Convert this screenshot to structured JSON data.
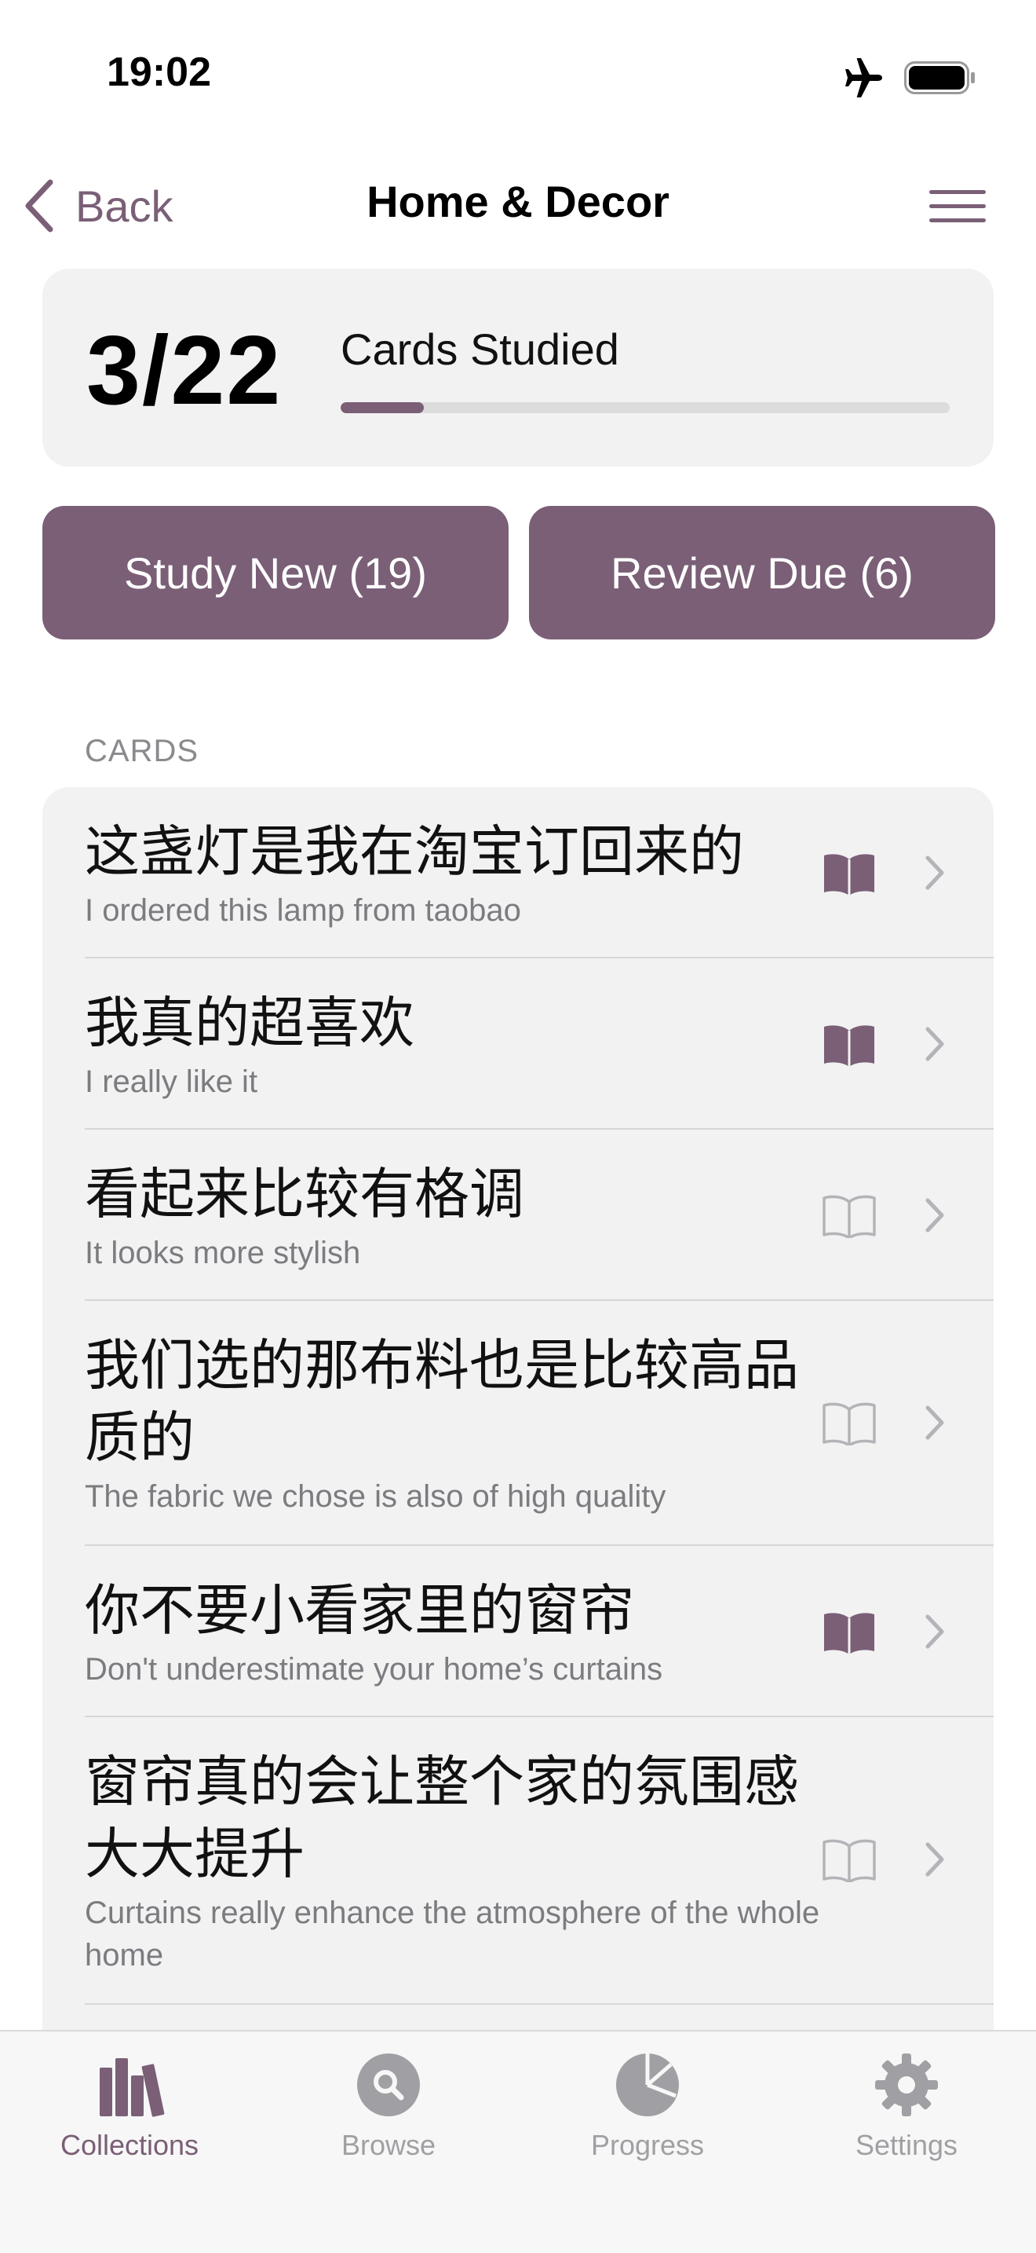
{
  "status_bar": {
    "time": "19:02"
  },
  "nav": {
    "back_label": "Back",
    "title": "Home & Decor"
  },
  "progress": {
    "count": "3/22",
    "label": "Cards Studied",
    "studied": 3,
    "total": 22
  },
  "actions": {
    "study_new": "Study New (19)",
    "review_due": "Review Due (6)"
  },
  "cards_header": "CARDS",
  "cards": [
    {
      "chinese": "这盏灯是我在淘宝订回来的",
      "english": "I ordered this lamp from taobao",
      "studied": true
    },
    {
      "chinese": "我真的超喜欢",
      "english": "I really like it",
      "studied": true
    },
    {
      "chinese": "看起来比较有格调",
      "english": "It looks more stylish",
      "studied": false
    },
    {
      "chinese": "我们选的那布料也是比较高品质的",
      "english": "The fabric we chose is also of high quality",
      "studied": false
    },
    {
      "chinese": "你不要小看家里的窗帘",
      "english": "Don't underestimate your home’s curtains",
      "studied": true
    },
    {
      "chinese": "窗帘真的会让整个家的氛围感大大提升",
      "english": "Curtains really enhance the atmosphere of the whole home",
      "studied": false
    }
  ],
  "tabs": [
    {
      "label": "Collections",
      "icon": "books-icon",
      "active": true
    },
    {
      "label": "Browse",
      "icon": "magnifier-icon",
      "active": false
    },
    {
      "label": "Progress",
      "icon": "pie-chart-icon",
      "active": false
    },
    {
      "label": "Settings",
      "icon": "gear-icon",
      "active": false
    }
  ],
  "colors": {
    "accent": "#7a5f76",
    "card_bg": "#f2f2f3",
    "muted": "#a0a0a4",
    "book_outline": "#b4b4b8"
  }
}
